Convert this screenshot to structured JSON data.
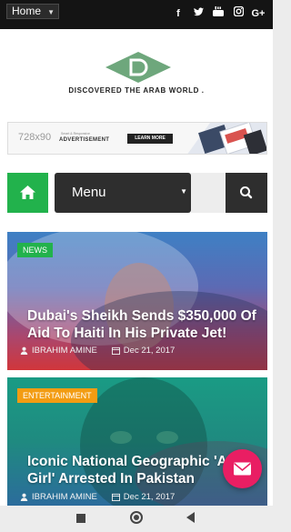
{
  "topbar": {
    "home_select": "Home",
    "social_icons": [
      "facebook-icon",
      "twitter-icon",
      "youtube-icon",
      "instagram-icon",
      "google-plus-icon"
    ],
    "social_labels": {
      "facebook": "f",
      "google_plus": "G+"
    }
  },
  "logo": {
    "tagline": "DISCOVERED THE ARAB WORLD ."
  },
  "ad": {
    "size": "728x90",
    "small_text": "Smart & Responsive",
    "label": "ADVERTISEMENT",
    "cta": "LEARN MORE"
  },
  "nav": {
    "menu_label": "Menu"
  },
  "articles": [
    {
      "category": "NEWS",
      "title": "Dubai's Sheikh Sends $350,000 Of Aid To Haiti In His Private Jet!",
      "author": "IBRAHIM AMINE",
      "date": "Dec 21, 2017"
    },
    {
      "category": "ENTERTAINMENT",
      "title": "Iconic National Geographic 'Afghan Girl' Arrested In Pakistan",
      "title_visible": "Iconic National Geographic 'Afg",
      "title_line2": "Girl' Arrested In Pakistan",
      "author": "IBRAHIM AMINE",
      "date": "Dec 21, 2017"
    }
  ],
  "colors": {
    "accent_green": "#22b24c",
    "badge_orange": "#f39c12",
    "fab_pink": "#e91e63",
    "dark": "#2e2e2e"
  }
}
